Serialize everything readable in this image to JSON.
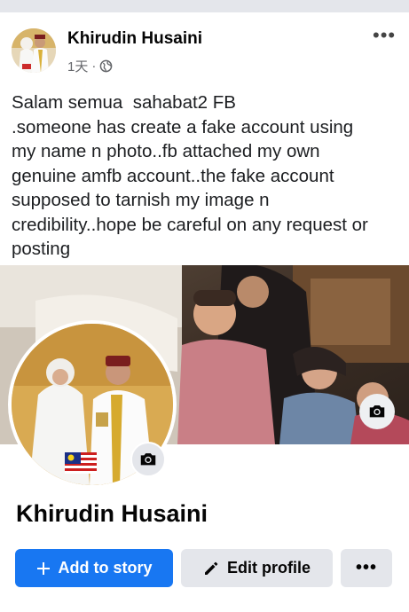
{
  "post": {
    "author": "Khirudin Husaini",
    "time": "1天",
    "separator": "·",
    "privacy_icon": "globe-icon",
    "more_icon": "more-horizontal-icon",
    "text_lines": [
      "Salam semua  sahabat2 FB",
      ".someone has create a fake account using",
      "my name n photo..fb attached my own",
      "genuine amfb account..the fake account",
      "supposed to tarnish my image n",
      "credibility..hope be careful on any request or",
      "posting"
    ]
  },
  "profile": {
    "name": "Khirudin Husaini",
    "add_story_label": "Add to story",
    "edit_profile_label": "Edit profile",
    "more_label": "•••",
    "camera_icon": "camera-icon",
    "plus_icon": "plus-icon",
    "pencil_icon": "pencil-icon"
  },
  "colors": {
    "primary": "#1877f2",
    "secondary_button": "#e4e6eb",
    "meta_text": "#65676b",
    "background": "#e4e6eb"
  }
}
